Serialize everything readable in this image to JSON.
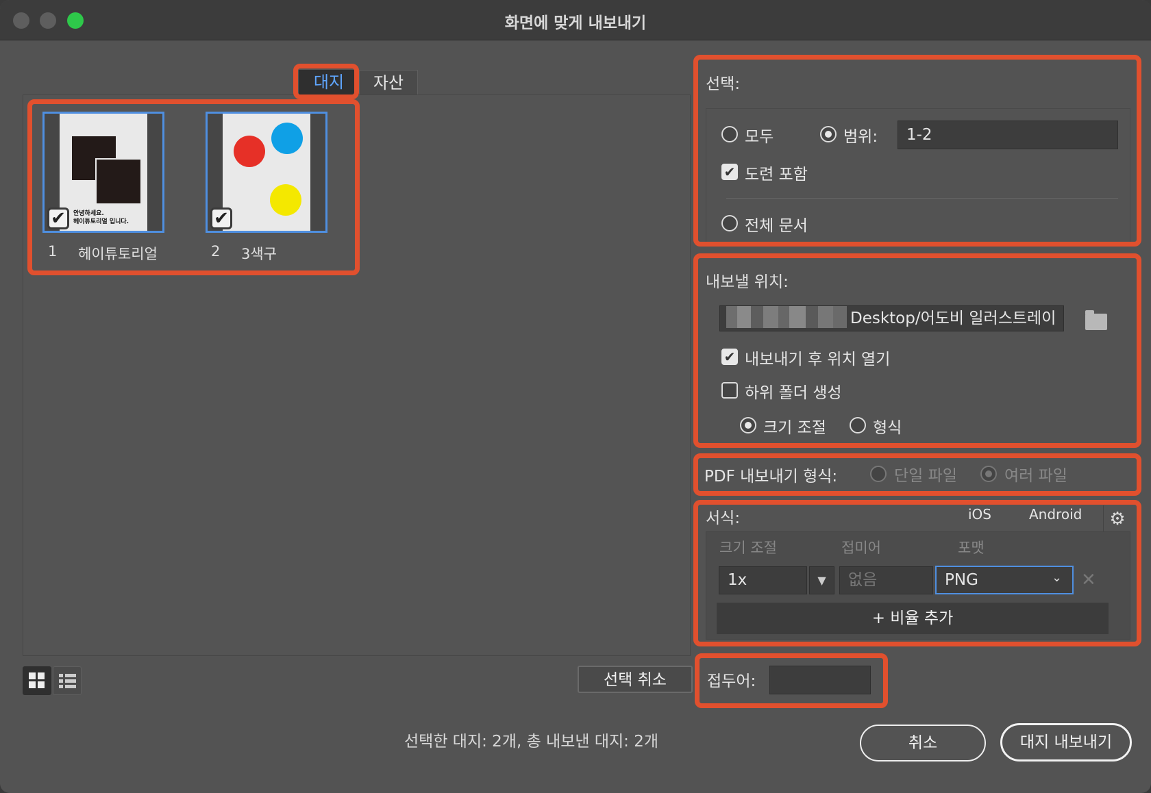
{
  "window": {
    "title": "화면에 맞게 내보내기"
  },
  "tabs": {
    "artboards": "대지",
    "assets": "자산"
  },
  "artboards": [
    {
      "number": "1",
      "name": "헤이튜토리얼",
      "thumb_text_1": "안녕하세요.",
      "thumb_text_2": "헤이튜토리얼 입니다.",
      "checked": true
    },
    {
      "number": "2",
      "name": "3색구",
      "checked": true
    }
  ],
  "select": {
    "title": "선택:",
    "all_label": "모두",
    "range_label": "범위:",
    "range_value": "1-2",
    "include_bleed_label": "도련 포함",
    "whole_doc_label": "전체 문서",
    "selected_option": "range"
  },
  "export_location": {
    "title": "내보낼 위치:",
    "path": "Desktop/어도비 일러스트레이",
    "open_after_label": "내보내기 후 위치 열기",
    "open_after_checked": true,
    "subfolder_label": "하위 폴더 생성",
    "subfolder_checked": false,
    "by_scale_label": "크기 조절",
    "by_format_label": "형식"
  },
  "pdf": {
    "label": "PDF 내보내기 형식:",
    "single_label": "단일 파일",
    "multiple_label": "여러 파일"
  },
  "formats": {
    "title": "서식:",
    "ios_label": "iOS",
    "android_label": "Android",
    "col_scale": "크기 조절",
    "col_suffix": "접미어",
    "col_format": "포맷",
    "scale_value": "1x",
    "suffix_placeholder": "없음",
    "format_value": "PNG",
    "add_scale_label": "+ 비율 추가"
  },
  "prefix": {
    "label": "접두어:",
    "value": ""
  },
  "footer": {
    "deselect_label": "선택 취소",
    "summary": "선택한 대지: 2개, 총 내보낸 대지: 2개",
    "cancel_label": "취소",
    "export_label": "대지 내보내기"
  },
  "colors": {
    "highlight": "#e1502e",
    "selection_blue": "#4f8fe0",
    "tab_active_text": "#5fa6ff"
  }
}
